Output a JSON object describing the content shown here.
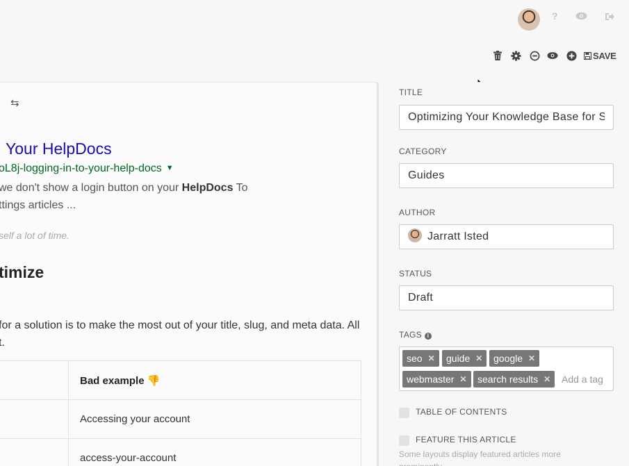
{
  "topbar": {
    "help_icon": "question-icon",
    "preview_icon": "eye-icon",
    "logout_icon": "sign-out-icon"
  },
  "toolbar": {
    "icons": [
      "trash-icon",
      "gear-icon",
      "history-icon",
      "eye-icon",
      "plus-circle-icon"
    ],
    "save_label": "SAVE"
  },
  "editor": {
    "google_preview": {
      "title": "Your HelpDocs",
      "url": "oL8j-logging-in-to-your-help-docs",
      "snippet_line1_pre": "we don't show a login button on your ",
      "snippet_line1_bold": "HelpDocs",
      "snippet_line1_post": " To",
      "snippet_line2": "ttings articles ..."
    },
    "caption": "self a lot of time.",
    "heading": "timize",
    "paragraph_line1": "for a solution is to make the most out of your title, slug, and meta data. All",
    "paragraph_line2": "t.",
    "table": {
      "header": [
        "",
        "Bad example 👎"
      ],
      "rows": [
        [
          "",
          "Accessing your account"
        ],
        [
          "",
          "access-your-account"
        ]
      ]
    }
  },
  "sidebar": {
    "title_label": "TITLE",
    "title_value": "Optimizing Your Knowledge Base for Search",
    "category_label": "CATEGORY",
    "category_value": "Guides",
    "author_label": "AUTHOR",
    "author_value": "Jarratt Isted",
    "status_label": "STATUS",
    "status_value": "Draft",
    "tags_label": "TAGS",
    "tags": [
      "seo",
      "guide",
      "google",
      "webmaster",
      "search results"
    ],
    "add_tag_placeholder": "Add a tag",
    "toc_label": "TABLE OF CONTENTS",
    "feature_label": "FEATURE THIS ARTICLE",
    "feature_hint": "Some layouts display featured articles more prominently."
  }
}
